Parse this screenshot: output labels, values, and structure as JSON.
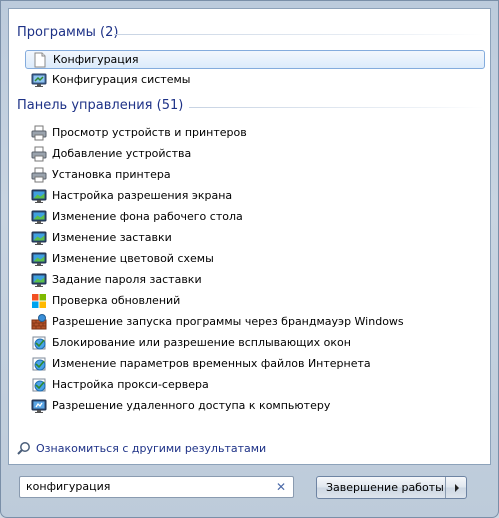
{
  "sections": [
    {
      "title": "Программы (2)"
    },
    {
      "title": "Панель управления (51)"
    }
  ],
  "programs": [
    {
      "label": "Конфигурация",
      "icon": "document-icon",
      "selected": true
    },
    {
      "label": "Конфигурация системы",
      "icon": "system-config-icon",
      "selected": false
    }
  ],
  "control_panel": [
    {
      "label": "Просмотр устройств и принтеров",
      "icon": "printer-icon"
    },
    {
      "label": "Добавление устройства",
      "icon": "printer-icon"
    },
    {
      "label": "Установка принтера",
      "icon": "printer-icon"
    },
    {
      "label": "Настройка разрешения экрана",
      "icon": "monitor-icon"
    },
    {
      "label": "Изменение фона рабочего стола",
      "icon": "monitor-icon"
    },
    {
      "label": "Изменение заставки",
      "icon": "monitor-icon"
    },
    {
      "label": "Изменение цветовой схемы",
      "icon": "monitor-icon"
    },
    {
      "label": "Задание пароля заставки",
      "icon": "monitor-icon"
    },
    {
      "label": "Проверка обновлений",
      "icon": "windows-update-icon"
    },
    {
      "label": "Разрешение запуска программы через брандмауэр Windows",
      "icon": "firewall-icon"
    },
    {
      "label": "Блокирование или разрешение всплывающих окон",
      "icon": "internet-options-icon"
    },
    {
      "label": "Изменение параметров временных файлов Интернета",
      "icon": "internet-options-icon"
    },
    {
      "label": "Настройка прокси-сервера",
      "icon": "internet-options-icon"
    },
    {
      "label": "Разрешение удаленного доступа к компьютеру",
      "icon": "remote-access-icon"
    }
  ],
  "more_results": "Ознакомиться с другими результатами",
  "search": {
    "value": "конфигурация"
  },
  "shutdown": {
    "label": "Завершение работы"
  }
}
